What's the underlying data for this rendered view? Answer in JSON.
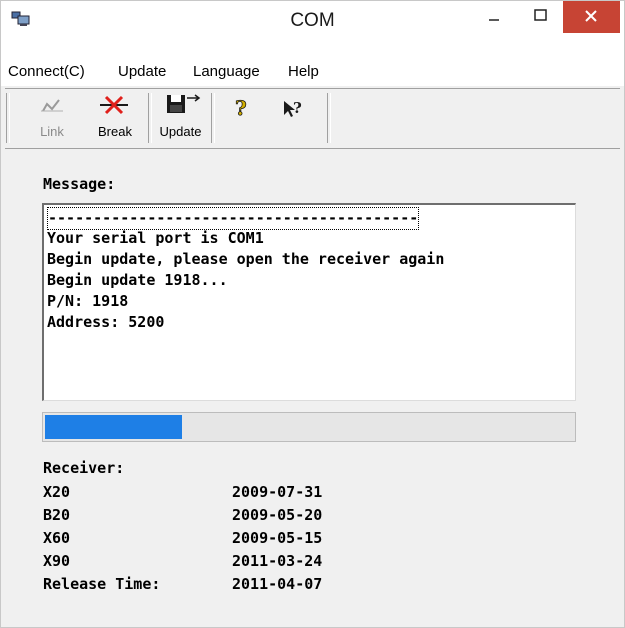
{
  "window": {
    "title": "COM"
  },
  "titlebar": {
    "minimize_glyph": "_",
    "close_glyph": "✕",
    "close_color": "#c74434"
  },
  "menu": {
    "items": [
      "Connect(C)",
      "Update",
      "Language",
      "Help"
    ]
  },
  "toolbar": {
    "link_label": "Link",
    "break_label": "Break",
    "update_label": "Update"
  },
  "message": {
    "label": "Message:",
    "lines": [
      "-----------------------------------------",
      "Your serial port is COM1",
      "Begin update, please open the receiver again",
      "Begin update 1918...",
      "P/N: 1918",
      "Address: 5200"
    ]
  },
  "progress": {
    "fraction": 0.26,
    "color": "#1e7fe6"
  },
  "receiver": {
    "label": "Receiver:",
    "rows": [
      {
        "name": "X20",
        "date": "2009-07-31"
      },
      {
        "name": "B20",
        "date": "2009-05-20"
      },
      {
        "name": "X60",
        "date": "2009-05-15"
      },
      {
        "name": "X90",
        "date": "2011-03-24"
      },
      {
        "name": "Release Time:",
        "date": "2011-04-07"
      }
    ]
  }
}
